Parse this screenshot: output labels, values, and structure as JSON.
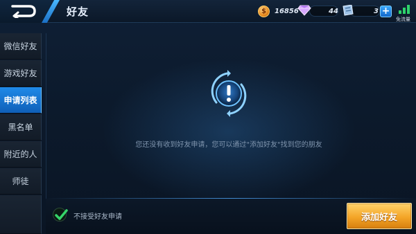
{
  "header": {
    "title": "好友",
    "gold": "16856",
    "diamonds": "44",
    "tickets": "3",
    "network_label": "免流量"
  },
  "sidebar": {
    "items": [
      {
        "label": "微信好友",
        "active": false
      },
      {
        "label": "游戏好友",
        "active": false
      },
      {
        "label": "申请列表",
        "active": true
      },
      {
        "label": "黑名单",
        "active": false
      },
      {
        "label": "附近的人",
        "active": false
      },
      {
        "label": "师徒",
        "active": false
      }
    ]
  },
  "main": {
    "empty_message": "您还没有收到好友申请，您可以通过\"添加好友\"找到您的朋友"
  },
  "footer": {
    "reject_requests_label": "不接受好友申请",
    "reject_requests_checked": true,
    "add_friend_label": "添加好友"
  },
  "colors": {
    "accent_blue": "#1f8ae8",
    "button_gold": "#f4a527",
    "signal_green": "#2ed26b"
  },
  "icons": {
    "back": "back-arrow-icon",
    "gold": "gold-coin-icon",
    "diamond": "diamond-icon",
    "ticket": "ticket-icon",
    "add": "plus-icon",
    "signal": "signal-icon",
    "info": "exclamation-icon",
    "check": "check-icon"
  }
}
